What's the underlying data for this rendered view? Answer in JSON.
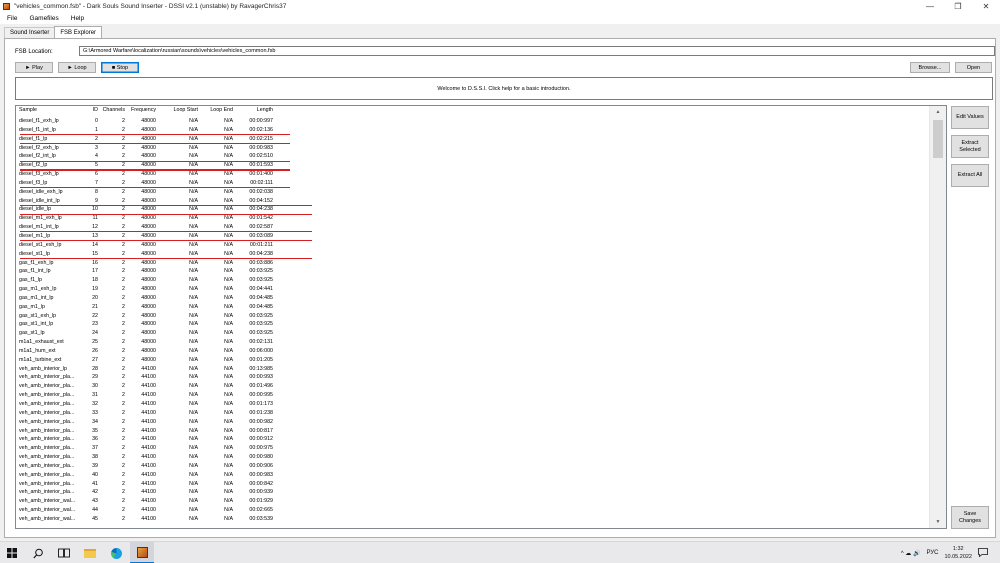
{
  "window": {
    "title": "\"vehicles_common.fsb\" - Dark Souls Sound Inserter - DSSI v2.1 (unstable) by RavagerChris37",
    "controls": {
      "minimize": "—",
      "maximize": "❐",
      "close": "✕"
    }
  },
  "menu": {
    "items": [
      "File",
      "Gamefiles",
      "Help"
    ]
  },
  "tabs": [
    {
      "label": "Sound Inserter",
      "active": false
    },
    {
      "label": "FSB Explorer",
      "active": true
    }
  ],
  "fsb": {
    "label": "FSB Location:",
    "path": "G:\\Armored Warfare\\localization\\russian\\sounds\\vehicles\\vehicles_common.fsb"
  },
  "toolbar": {
    "play": "► Play",
    "loop": "► Loop",
    "stop": "■ Stop",
    "browse": "Browse...",
    "open": "Open"
  },
  "welcome": "Welcome to D.S.S.I. Click help for a basic introduction.",
  "table": {
    "columns": [
      "Sample",
      "ID",
      "Channels",
      "Frequency",
      "Loop Start",
      "Loop End",
      "Length"
    ],
    "rows": [
      [
        "diesel_f1_exh_lp",
        "0",
        "2",
        "48000",
        "N/A",
        "N/A",
        "00:00:997",
        false
      ],
      [
        "diesel_f1_int_lp",
        "1",
        "2",
        "48000",
        "N/A",
        "N/A",
        "00:02:136",
        true
      ],
      [
        "diesel_f1_lp",
        "2",
        "2",
        "48000",
        "N/A",
        "N/A",
        "00:02:215",
        true
      ],
      [
        "diesel_f2_exh_lp",
        "3",
        "2",
        "48000",
        "N/A",
        "N/A",
        "00:00:983",
        false
      ],
      [
        "diesel_f2_int_lp",
        "4",
        "2",
        "48000",
        "N/A",
        "N/A",
        "00:02:510",
        true
      ],
      [
        "diesel_f2_lp",
        "5",
        "2",
        "48000",
        "N/A",
        "N/A",
        "00:01:593",
        true
      ],
      [
        "diesel_f3_exh_lp",
        "6",
        "2",
        "48000",
        "N/A",
        "N/A",
        "00:01:400",
        false
      ],
      [
        "diesel_f3_lp",
        "7",
        "2",
        "48000",
        "N/A",
        "N/A",
        "00:02:111",
        true
      ],
      [
        "diesel_idle_exh_lp",
        "8",
        "2",
        "48000",
        "N/A",
        "N/A",
        "00:02:038",
        false
      ],
      [
        "diesel_idle_int_lp",
        "9",
        "2",
        "48000",
        "N/A",
        "N/A",
        "00:04:152",
        true
      ],
      [
        "diesel_idle_lp",
        "10",
        "2",
        "48000",
        "N/A",
        "N/A",
        "00:04:238",
        true
      ],
      [
        "diesel_m1_exh_lp",
        "11",
        "2",
        "48000",
        "N/A",
        "N/A",
        "00:01:542",
        false
      ],
      [
        "diesel_m1_int_lp",
        "12",
        "2",
        "48000",
        "N/A",
        "N/A",
        "00:02:587",
        true
      ],
      [
        "diesel_m1_lp",
        "13",
        "2",
        "48000",
        "N/A",
        "N/A",
        "00:03:089",
        true
      ],
      [
        "diesel_st1_exh_lp",
        "14",
        "2",
        "48000",
        "N/A",
        "N/A",
        "00:01:211",
        false
      ],
      [
        "diesel_st1_lp",
        "15",
        "2",
        "48000",
        "N/A",
        "N/A",
        "00:04:238",
        true
      ],
      [
        "gas_f1_exh_lp",
        "16",
        "2",
        "48000",
        "N/A",
        "N/A",
        "00:03:886",
        false
      ],
      [
        "gas_f1_int_lp",
        "17",
        "2",
        "48000",
        "N/A",
        "N/A",
        "00:03:925",
        false
      ],
      [
        "gas_f1_lp",
        "18",
        "2",
        "48000",
        "N/A",
        "N/A",
        "00:03:925",
        false
      ],
      [
        "gas_m1_exh_lp",
        "19",
        "2",
        "48000",
        "N/A",
        "N/A",
        "00:04:441",
        false
      ],
      [
        "gas_m1_int_lp",
        "20",
        "2",
        "48000",
        "N/A",
        "N/A",
        "00:04:485",
        false
      ],
      [
        "gas_m1_lp",
        "21",
        "2",
        "48000",
        "N/A",
        "N/A",
        "00:04:485",
        false
      ],
      [
        "gas_st1_exh_lp",
        "22",
        "2",
        "48000",
        "N/A",
        "N/A",
        "00:03:925",
        false
      ],
      [
        "gas_st1_int_lp",
        "23",
        "2",
        "48000",
        "N/A",
        "N/A",
        "00:03:925",
        false
      ],
      [
        "gas_st1_lp",
        "24",
        "2",
        "48000",
        "N/A",
        "N/A",
        "00:03:925",
        false
      ],
      [
        "m1a1_exhaust_ext",
        "25",
        "2",
        "48000",
        "N/A",
        "N/A",
        "00:02:131",
        false
      ],
      [
        "m1a1_hum_ext",
        "26",
        "2",
        "48000",
        "N/A",
        "N/A",
        "00:06:000",
        false
      ],
      [
        "m1a1_turbine_ext",
        "27",
        "2",
        "48000",
        "N/A",
        "N/A",
        "00:01:205",
        false
      ],
      [
        "veh_amb_interior_lp",
        "28",
        "2",
        "44100",
        "N/A",
        "N/A",
        "00:13:985",
        false
      ],
      [
        "veh_amb_interior_pla...",
        "29",
        "2",
        "44100",
        "N/A",
        "N/A",
        "00:00:993",
        false
      ],
      [
        "veh_amb_interior_pla...",
        "30",
        "2",
        "44100",
        "N/A",
        "N/A",
        "00:01:496",
        false
      ],
      [
        "veh_amb_interior_pla...",
        "31",
        "2",
        "44100",
        "N/A",
        "N/A",
        "00:00:995",
        false
      ],
      [
        "veh_amb_interior_pla...",
        "32",
        "2",
        "44100",
        "N/A",
        "N/A",
        "00:01:173",
        false
      ],
      [
        "veh_amb_interior_pla...",
        "33",
        "2",
        "44100",
        "N/A",
        "N/A",
        "00:01:238",
        false
      ],
      [
        "veh_amb_interior_pla...",
        "34",
        "2",
        "44100",
        "N/A",
        "N/A",
        "00:00:982",
        false
      ],
      [
        "veh_amb_interior_pla...",
        "35",
        "2",
        "44100",
        "N/A",
        "N/A",
        "00:00:817",
        false
      ],
      [
        "veh_amb_interior_pla...",
        "36",
        "2",
        "44100",
        "N/A",
        "N/A",
        "00:00:912",
        false
      ],
      [
        "veh_amb_interior_pla...",
        "37",
        "2",
        "44100",
        "N/A",
        "N/A",
        "00:00:975",
        false
      ],
      [
        "veh_amb_interior_pla...",
        "38",
        "2",
        "44100",
        "N/A",
        "N/A",
        "00:00:980",
        false
      ],
      [
        "veh_amb_interior_pla...",
        "39",
        "2",
        "44100",
        "N/A",
        "N/A",
        "00:00:906",
        false
      ],
      [
        "veh_amb_interior_pla...",
        "40",
        "2",
        "44100",
        "N/A",
        "N/A",
        "00:00:983",
        false
      ],
      [
        "veh_amb_interior_pla...",
        "41",
        "2",
        "44100",
        "N/A",
        "N/A",
        "00:00:842",
        false
      ],
      [
        "veh_amb_interior_pla...",
        "42",
        "2",
        "44100",
        "N/A",
        "N/A",
        "00:00:939",
        false
      ],
      [
        "veh_amb_interior_wal...",
        "43",
        "2",
        "44100",
        "N/A",
        "N/A",
        "00:01:929",
        false
      ],
      [
        "veh_amb_interior_wal...",
        "44",
        "2",
        "44100",
        "N/A",
        "N/A",
        "00:02:665",
        false
      ],
      [
        "veh_amb_interior_wal...",
        "45",
        "2",
        "44100",
        "N/A",
        "N/A",
        "00:03:539",
        false
      ]
    ]
  },
  "side_buttons": {
    "edit": "Edit Values",
    "extract_selected": "Extract Selected",
    "extract_all": "Extract All",
    "save": "Save Changes"
  },
  "scrollbar": {
    "up": "▲",
    "down": "▼"
  },
  "taskbar": {
    "lang": "РУС",
    "time": "1:32",
    "date": "10.05.2022",
    "tray_icons": "^  ☁  🔊"
  },
  "colors": {
    "highlight_underline": "#d42020",
    "focus": "#0078d7"
  }
}
